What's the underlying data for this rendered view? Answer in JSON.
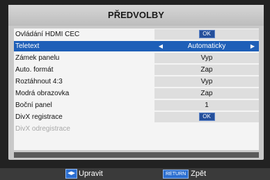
{
  "title": "PŘEDVOLBY",
  "rows": [
    {
      "label": "Ovládání HDMI CEC",
      "value": "OK",
      "kind": "button"
    },
    {
      "label": "Teletext",
      "value": "Automaticky",
      "kind": "selected"
    },
    {
      "label": "Zámek panelu",
      "value": "Vyp",
      "kind": "value"
    },
    {
      "label": "Auto. formát",
      "value": "Zap",
      "kind": "value"
    },
    {
      "label": "Roztáhnout 4:3",
      "value": "Vyp",
      "kind": "value"
    },
    {
      "label": "Modrá obrazovka",
      "value": "Zap",
      "kind": "value"
    },
    {
      "label": "Boční panel",
      "value": "1",
      "kind": "value"
    },
    {
      "label": "DivX registrace",
      "value": "OK",
      "kind": "button"
    },
    {
      "label": "DivX odregistrace",
      "value": "",
      "kind": "disabled"
    }
  ],
  "footer": {
    "edit_icon": "arrow-left-right-icon",
    "edit_label": "Upravit",
    "return_key": "RETURN",
    "back_label": "Zpět"
  },
  "colors": {
    "selection": "#1e5fb8",
    "button": "#244f9b",
    "key": "#2c6fd1"
  }
}
